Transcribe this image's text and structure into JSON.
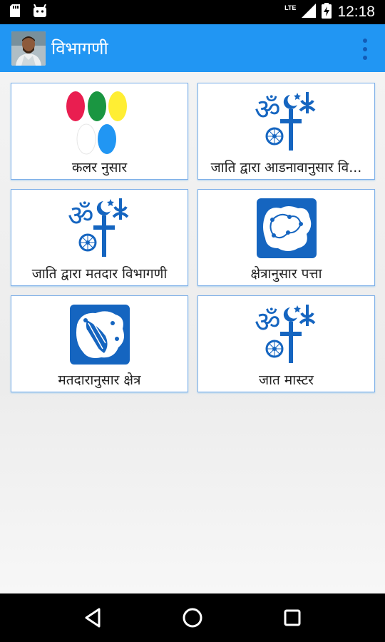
{
  "status_bar": {
    "time": "12:18",
    "network": "LTE",
    "icons": [
      "sd-card-icon",
      "android-icon",
      "signal-icon",
      "battery-charging-icon"
    ]
  },
  "app_bar": {
    "title": "विभागणी",
    "overflow_icon": "more-vert-icon"
  },
  "tiles": [
    {
      "label": "कलर नुसार",
      "icon": "color-dots-icon"
    },
    {
      "label": "जाति द्वारा आडनावानुसार वि...",
      "icon": "religion-symbols-icon"
    },
    {
      "label": "जाति द्वारा मतदार विभागणी",
      "icon": "religion-symbols-icon"
    },
    {
      "label": "क्षेत्रानुसार पत्ता",
      "icon": "area-map-icon"
    },
    {
      "label": "मतदारानुसार क्षेत्र",
      "icon": "area-map-icon"
    },
    {
      "label": "जात मास्टर",
      "icon": "religion-symbols-icon"
    }
  ],
  "colors": {
    "app_bar": "#2196f3",
    "icon_blue": "#1565c0",
    "dot_red": "#e91e50",
    "dot_green": "#1a9641",
    "dot_yellow": "#ffeb3b",
    "dot_light_blue": "#2196f3"
  },
  "nav_bar": {
    "icons": [
      "back-icon",
      "home-icon",
      "recents-icon"
    ]
  }
}
